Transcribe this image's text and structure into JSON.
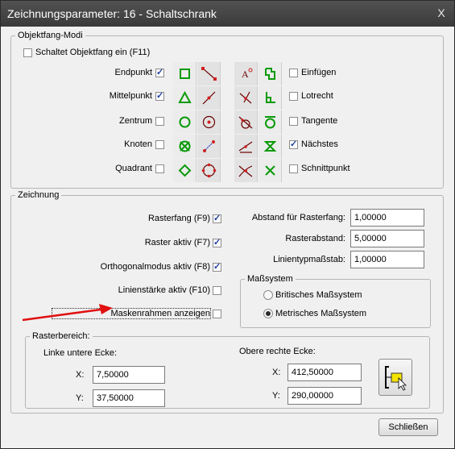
{
  "window": {
    "title": "Zeichnungsparameter: 16 - Schaltschrank",
    "close_glyph": "X"
  },
  "objektfang": {
    "group_title": "Objektfang-Modi",
    "master_label": "Schaltet Objektfang ein (F11)",
    "master_checked": false,
    "left_items": [
      {
        "label": "Endpunkt",
        "checked": true
      },
      {
        "label": "Mittelpunkt",
        "checked": true
      },
      {
        "label": "Zentrum",
        "checked": false
      },
      {
        "label": "Knoten",
        "checked": false
      },
      {
        "label": "Quadrant",
        "checked": false
      }
    ],
    "right_items": [
      {
        "label": "Einfügen",
        "checked": false
      },
      {
        "label": "Lotrecht",
        "checked": false
      },
      {
        "label": "Tangente",
        "checked": false
      },
      {
        "label": "Nächstes",
        "checked": true
      },
      {
        "label": "Schnittpunkt",
        "checked": false
      }
    ],
    "icons_left_col1": [
      "endpoint-square-icon",
      "midpoint-triangle-icon",
      "center-circle-icon",
      "node-circle-x-icon",
      "quadrant-diamond-icon"
    ],
    "icons_left_col2": [
      "endpoint-line-icon",
      "midpoint-line-icon",
      "center-circle-dot-icon",
      "node-arrow-icon",
      "quadrant-circle-points-icon"
    ],
    "icons_right_col1": [
      "insert-text-icon",
      "perpendicular-lines-icon",
      "tangent-arc-icon",
      "nearest-line-icon",
      "intersection-curves-icon"
    ],
    "icons_right_col2": [
      "insert-block-icon",
      "perpendicular-icon",
      "tangent-circle-icon",
      "nearest-hourglass-icon",
      "intersection-x-icon"
    ]
  },
  "zeichnung": {
    "group_title": "Zeichnung",
    "checks": [
      {
        "label": "Rasterfang (F9)",
        "checked": true
      },
      {
        "label": "Raster aktiv (F7)",
        "checked": true
      },
      {
        "label": "Orthogonalmodus aktiv (F8)",
        "checked": true
      },
      {
        "label": "Linienstärke aktiv (F10)",
        "checked": false
      },
      {
        "label": "Maskenrahmen anzeigen",
        "checked": false
      }
    ],
    "fields": [
      {
        "label": "Abstand für Rasterfang:",
        "value": "1,00000"
      },
      {
        "label": "Rasterabstand:",
        "value": "5,00000"
      },
      {
        "label": "Linientypmaßstab:",
        "value": "1,00000"
      }
    ],
    "masssystem": {
      "title": "Maßsystem",
      "options": [
        {
          "label": "Britisches Maßsystem",
          "checked": false
        },
        {
          "label": "Metrisches Maßsystem",
          "checked": true
        }
      ]
    },
    "annotation_color": "#e01010"
  },
  "rasterbereich": {
    "title": "Rasterbereich:",
    "lower_left_title": "Linke untere Ecke:",
    "upper_right_title": "Obere rechte Ecke:",
    "x_label": "X:",
    "y_label": "Y:",
    "ll_x": "7,50000",
    "ll_y": "37,50000",
    "ur_x": "412,50000",
    "ur_y": "290,00000",
    "pick_icon": "pick-rectangle-icon"
  },
  "footer": {
    "close_label": "Schließen"
  }
}
